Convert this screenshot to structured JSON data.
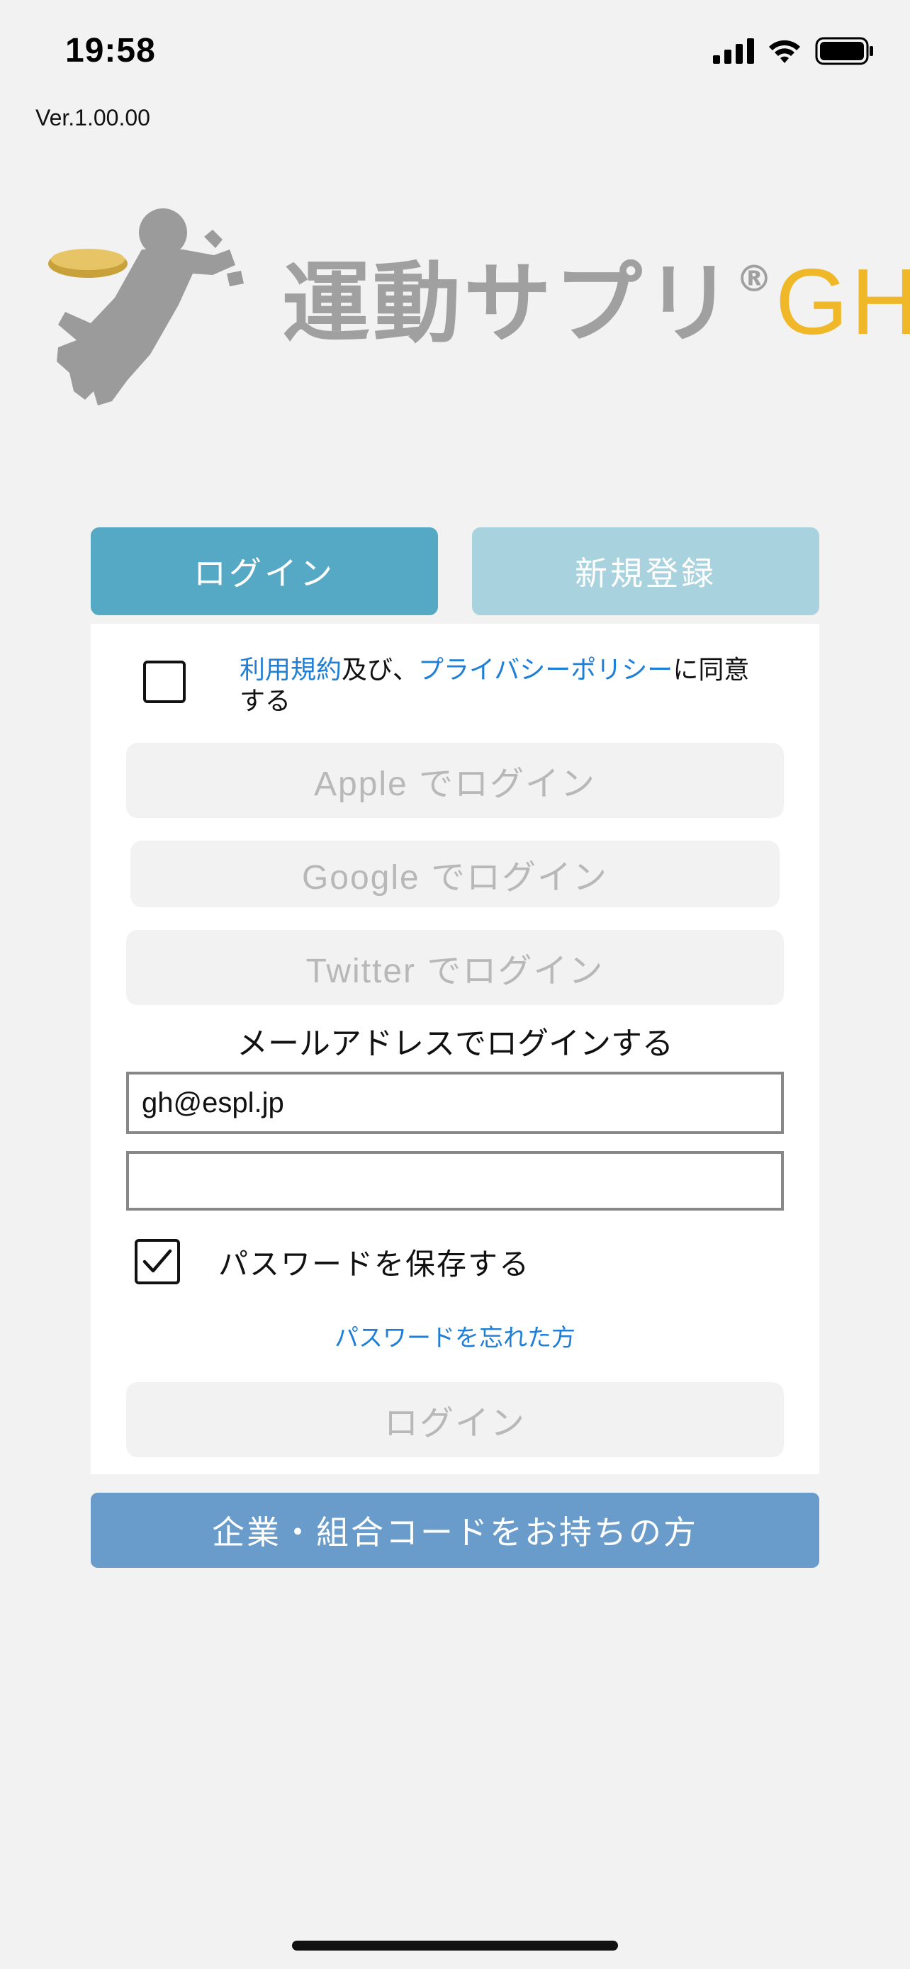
{
  "status_bar": {
    "time": "19:58",
    "icons": [
      "cellular-signal-icon",
      "wifi-icon",
      "battery-icon"
    ]
  },
  "version": "Ver.1.00.00",
  "logo": {
    "text": "運動サプリ",
    "registered": "®",
    "suffix": "GH",
    "colors": {
      "text": "#a0a0a0",
      "suffix": "#f0b728",
      "coin": "#c9a13a"
    }
  },
  "tabs": [
    {
      "label": "ログイン",
      "active": true,
      "color": "#56a9c4"
    },
    {
      "label": "新規登録",
      "active": false,
      "color": "#a9d2df"
    }
  ],
  "terms": {
    "checked": false,
    "link_terms": "利用規約",
    "text_mid": "及び、",
    "link_privacy": "プライバシーポリシー",
    "text_end": "に同意する",
    "link_color": "#1f7fd6"
  },
  "sso": {
    "apple_label": "Apple でログイン",
    "google_label": "Google でログイン",
    "twitter_label": "Twitter でログイン"
  },
  "email_login": {
    "heading": "メールアドレスでログインする",
    "email_value": "gh@espl.jp",
    "password_value": "",
    "save_password_label": "パスワードを保存する",
    "save_password_checked": true,
    "forgot_password_link": "パスワードを忘れた方",
    "login_button": "ログイン"
  },
  "corporate_button": {
    "label": "企業・組合コードをお持ちの方",
    "color": "#6a9ccb"
  }
}
